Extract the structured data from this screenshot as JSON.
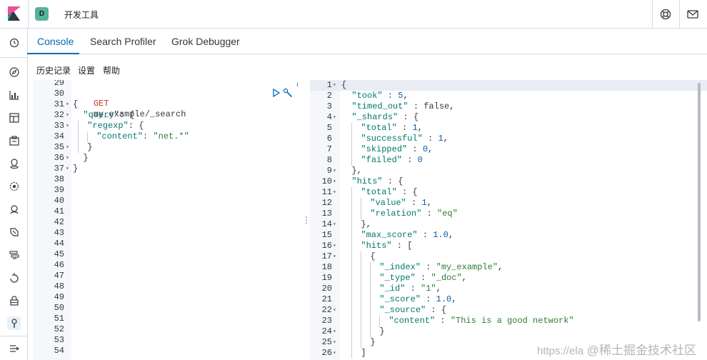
{
  "header": {
    "space_initial": "D",
    "app_title": "开发工具"
  },
  "tabs": [
    {
      "label": "Console",
      "active": true
    },
    {
      "label": "Search Profiler",
      "active": false
    },
    {
      "label": "Grok Debugger",
      "active": false
    }
  ],
  "menu": [
    "历史记录",
    "设置",
    "帮助"
  ],
  "request_editor": {
    "line_numbers": [
      "29",
      "30",
      "31",
      "32",
      "33",
      "34",
      "35",
      "36",
      "37",
      "38",
      "39",
      "40",
      "41",
      "42",
      "43",
      "44",
      "45",
      "46",
      "47",
      "48",
      "49",
      "50",
      "51",
      "52",
      "53",
      "54"
    ],
    "method": "GET",
    "path": "my_example/_search",
    "lines": [
      "{",
      "\"query\": {",
      "\"regexp\": {",
      "\"content\": \"net.*\"",
      "}",
      "}",
      "}"
    ]
  },
  "response_editor": {
    "line_numbers": [
      "1",
      "2",
      "3",
      "4",
      "5",
      "6",
      "7",
      "8",
      "9",
      "10",
      "11",
      "12",
      "13",
      "14",
      "15",
      "16",
      "17",
      "18",
      "19",
      "20",
      "21",
      "22",
      "23",
      "24",
      "25",
      "26"
    ],
    "lines": [
      "{",
      "\"took\" : 5,",
      "\"timed_out\" : false,",
      "\"_shards\" : {",
      "\"total\" : 1,",
      "\"successful\" : 1,",
      "\"skipped\" : 0,",
      "\"failed\" : 0",
      "},",
      "\"hits\" : {",
      "\"total\" : {",
      "\"value\" : 1,",
      "\"relation\" : \"eq\"",
      "},",
      "\"max_score\" : 1.0,",
      "\"hits\" : [",
      "{",
      "\"_index\" : \"my_example\",",
      "\"_type\" : \"_doc\",",
      "\"_id\" : \"1\",",
      "\"_score\" : 1.0,",
      "\"_source\" : {",
      "\"content\" : \"This is a good network\"",
      "}",
      "}",
      "]"
    ]
  },
  "watermark": {
    "url": "https://ela",
    "text": "@稀土掘金技术社区"
  },
  "colors": {
    "accent": "#006bb4",
    "space_avatar": "#54b399",
    "logo_pink": "#f04e98",
    "logo_teal": "#00bfb3"
  }
}
